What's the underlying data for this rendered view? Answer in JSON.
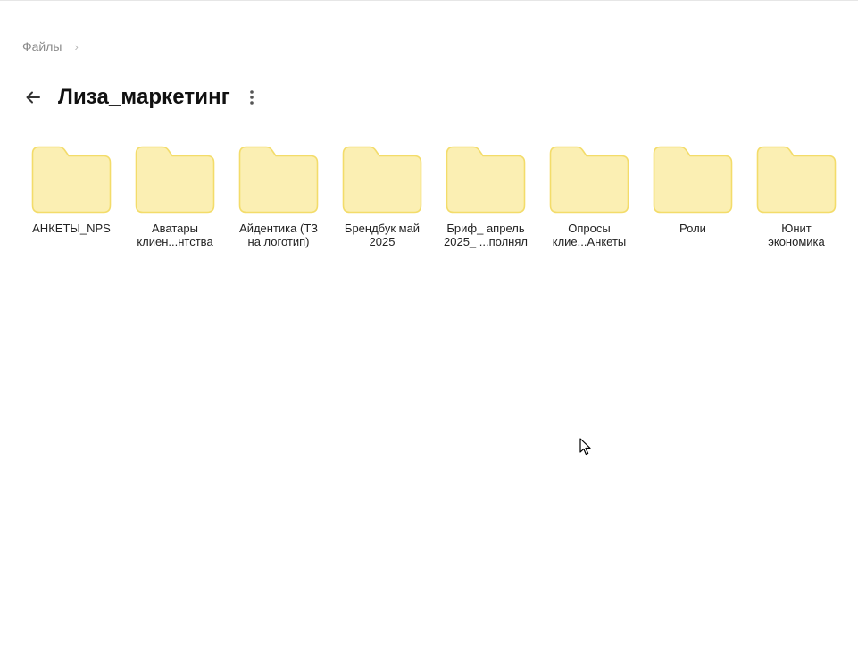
{
  "breadcrumb": {
    "root": "Файлы",
    "separator": "›"
  },
  "header": {
    "title": "Лиза_маркетинг",
    "back_icon": "arrow-left-icon",
    "more_icon": "vertical-dots-icon"
  },
  "folders": [
    {
      "name": "АНКЕТЫ_NPS"
    },
    {
      "name": "Аватары\nклиен...нтства"
    },
    {
      "name": "Айдентика (ТЗ\nна логотип)"
    },
    {
      "name": "Брендбук май\n2025"
    },
    {
      "name": "Бриф_ апрель\n2025_ ...полнял"
    },
    {
      "name": "Опросы\nклие...Анкеты"
    },
    {
      "name": "Роли"
    },
    {
      "name": "Юнит\nэкономика"
    }
  ],
  "colors": {
    "folder_fill": "#fbefb3",
    "folder_stroke": "#f3dc6a",
    "title": "#111111",
    "breadcrumb": "#8a8a8a"
  }
}
